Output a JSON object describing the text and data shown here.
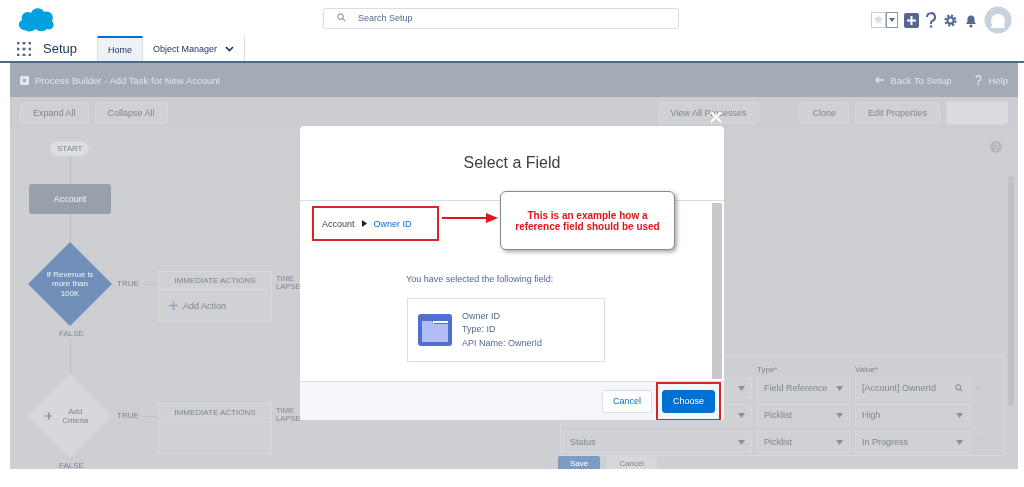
{
  "header": {
    "search_placeholder": "Search Setup"
  },
  "nav": {
    "app_name": "Setup",
    "tabs": [
      {
        "label": "Home",
        "selected": true
      },
      {
        "label": "Object Manager",
        "selected": false
      }
    ]
  },
  "page_header": {
    "title": "Process Builder - Add Task for New Account",
    "back_link": "Back To Setup",
    "help_link": "Help"
  },
  "toolbar": {
    "left_buttons": [
      "Expand All",
      "Collapse All"
    ],
    "right_buttons": [
      "View All Processes",
      "Clone",
      "Edit Properties"
    ]
  },
  "flow": {
    "start": "START",
    "object": "Account",
    "criteria": [
      {
        "kind": "defined",
        "label": "If Revenue is more than 100K",
        "true_label": "TRUE",
        "false_label": "FALSE",
        "actions_header": "IMMEDIATE ACTIONS",
        "action": "Add Action",
        "time_label": "TIME LAPSE"
      },
      {
        "kind": "placeholder",
        "label": "Add Criteria",
        "true_label": "TRUE",
        "false_label": "FALSE",
        "actions_header": "IMMEDIATE ACTIONS",
        "time_label": "TIME LAPSE"
      }
    ]
  },
  "panel": {
    "columns": [
      "Type*",
      "Value*"
    ],
    "rows": [
      {
        "type": "Field Reference",
        "value": "[Account].OwnerId",
        "kind": "lookup"
      },
      {
        "type": "Picklist",
        "value": "High",
        "kind": "picklist"
      },
      {
        "field": "Status",
        "type": "Picklist",
        "value": "In Progress",
        "kind": "picklist"
      }
    ],
    "save": "Save",
    "cancel": "Cancel"
  },
  "modal": {
    "title": "Select a Field",
    "breadcrumb": [
      {
        "label": "Account",
        "link": false
      },
      {
        "label": "Owner ID",
        "link": true
      }
    ],
    "prompt": "You have selected the following field:",
    "field_card": {
      "name": "Owner ID",
      "type": "Type: ID",
      "api_name": "API Name: OwnerId"
    },
    "buttons": [
      {
        "label": "Cancel",
        "kind": "neutral",
        "highlighted": false
      },
      {
        "label": "Choose",
        "kind": "brand",
        "highlighted": true
      }
    ]
  },
  "annotation": {
    "text": "This is an example how a reference field should be used"
  }
}
